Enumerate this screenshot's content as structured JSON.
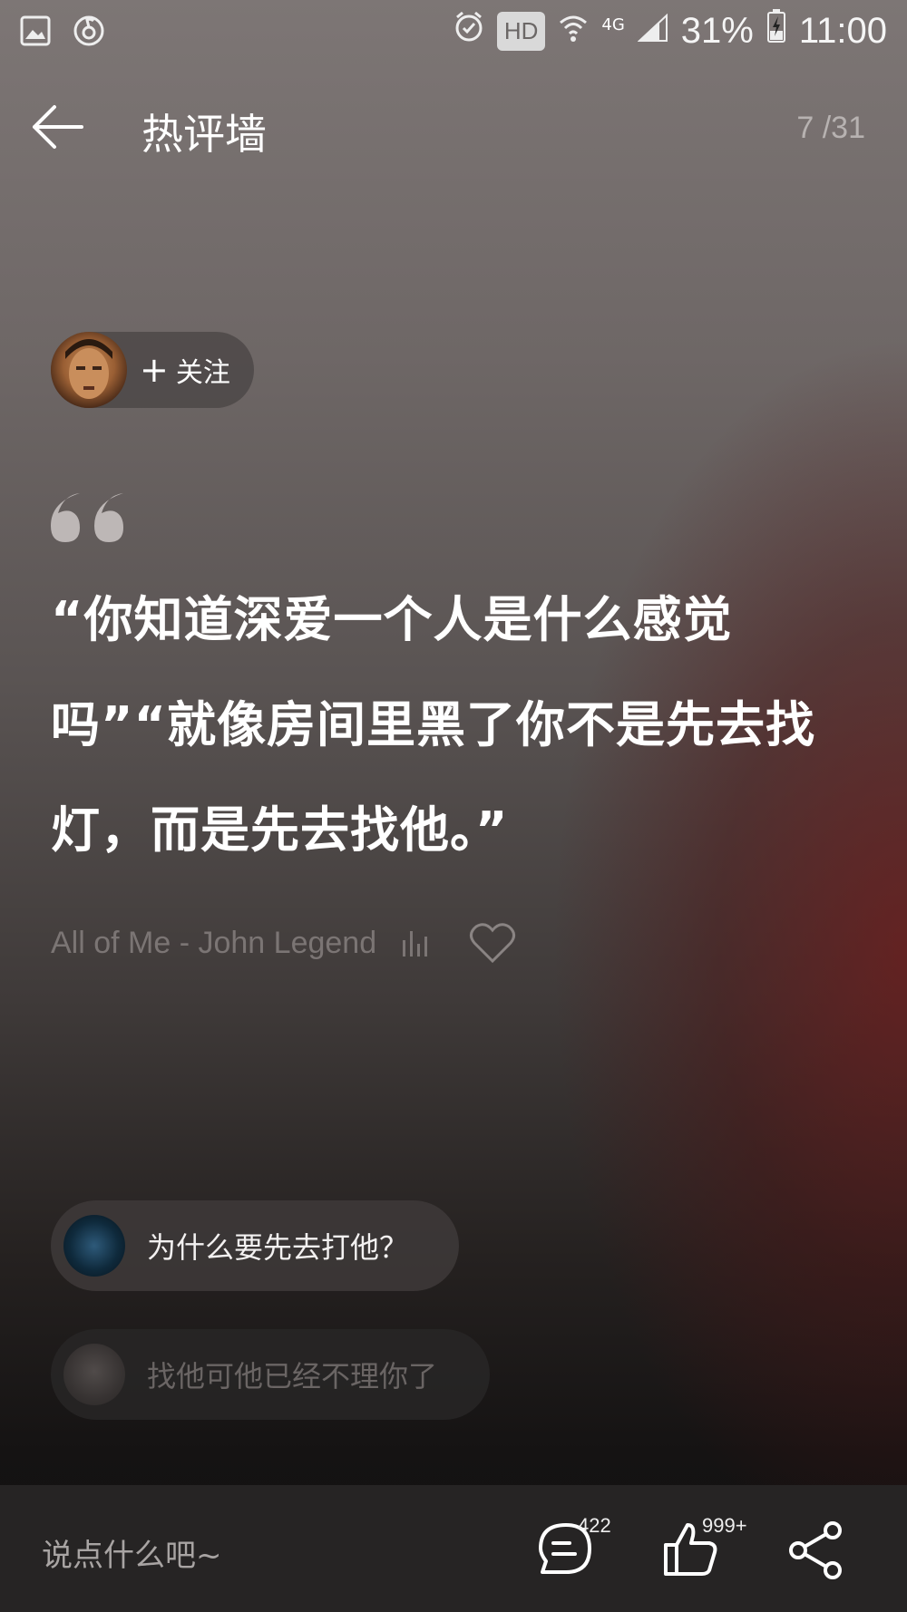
{
  "status_bar": {
    "hd": "HD",
    "network": "4G",
    "battery": "31%",
    "time": "11:00",
    "icons": [
      "image-icon",
      "netease-music-icon",
      "alarm-icon",
      "wifi-icon",
      "signal-icon",
      "battery-charging-icon"
    ]
  },
  "header": {
    "title": "热评墙",
    "pager": "7 /31"
  },
  "author": {
    "follow_label": "关注",
    "follow_plus": "+"
  },
  "quote": {
    "text": "“你知道深爱一个人是什么感觉吗”“就像房间里黑了你不是先去找灯，而是先去找他。”"
  },
  "song": {
    "title": "All of Me - John Legend"
  },
  "replies": [
    {
      "text": "为什么要先去打他？"
    },
    {
      "text": "找他可他已经不理你了"
    }
  ],
  "bottom_bar": {
    "input_placeholder": "说点什么吧~",
    "comment_count": "422",
    "like_count": "999+"
  },
  "colors": {
    "accent_text": "#ffffff",
    "muted_text": "#7b7574",
    "bottom_bar_bg": "#262424"
  }
}
